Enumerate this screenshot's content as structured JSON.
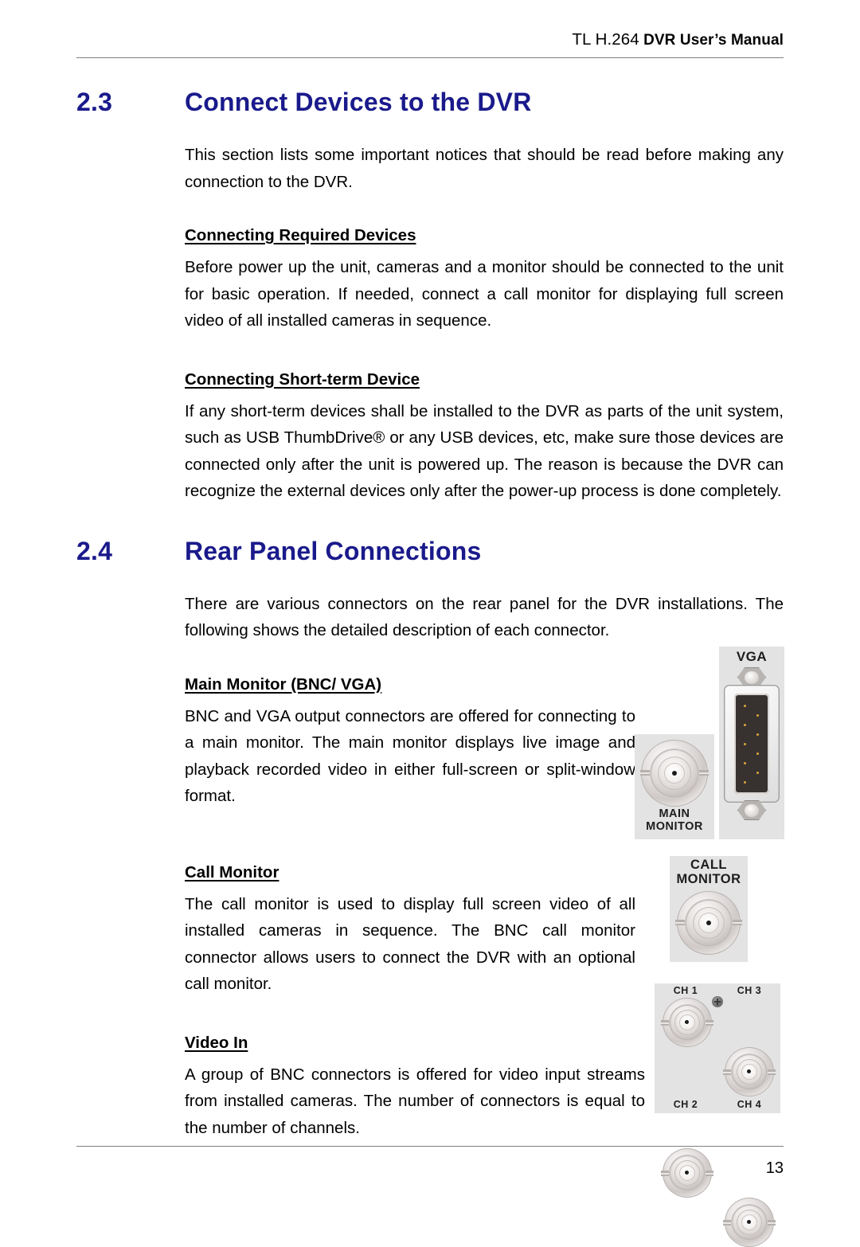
{
  "header": {
    "model": "TL H.264",
    "title": "DVR User’s Manual"
  },
  "footer": {
    "page_number": "13"
  },
  "colors": {
    "heading_blue": "#1a1a8c",
    "rule_gray": "#808080",
    "art_background": "#e3e3e3"
  },
  "sections": [
    {
      "number": "2.3",
      "title": "Connect Devices to the DVR",
      "intro": "This section lists some important notices that should be read before making any connection to the DVR.",
      "subsections": [
        {
          "heading": "Connecting Required Devices",
          "body": "Before power up the unit, cameras and a monitor should be connected to the unit for basic operation. If needed, connect a call monitor for displaying full screen video of all installed cameras in sequence."
        },
        {
          "heading": "Connecting Short-term Device",
          "body": "If any short-term devices shall be installed to the DVR as parts of the unit system, such as USB ThumbDrive® or any USB devices, etc, make sure those devices are connected only after the unit is powered up. The reason is because the DVR can recognize the external devices only after the power-up process is done completely."
        }
      ]
    },
    {
      "number": "2.4",
      "title": "Rear Panel Connections",
      "intro": "There are various connectors on the rear panel for the DVR installations. The following shows the detailed description of each connector.",
      "subsections": [
        {
          "heading": "Main Monitor (BNC/ VGA)",
          "body": "BNC and VGA output connectors are offered for connecting to a main monitor. The main monitor displays live image and playback recorded video in either full-screen or split-window format."
        },
        {
          "heading": "Call Monitor",
          "body": "The call monitor is used to display full screen video of all installed cameras in sequence. The BNC call monitor connector allows users to connect the DVR with an optional call monitor."
        },
        {
          "heading": "Video In",
          "body": "A group of BNC connectors is offered for video input streams from installed cameras. The number of connectors is equal to the number of channels."
        }
      ]
    }
  ],
  "artwork": {
    "main_monitor_panel": {
      "bnc_label_line1": "MAIN",
      "bnc_label_line2": "MONITOR",
      "vga_label": "VGA"
    },
    "call_monitor_panel": {
      "label_line1": "CALL",
      "label_line2": "MONITOR"
    },
    "video_in_panel": {
      "channel_top_left": "CH 1",
      "channel_top_right": "CH 3",
      "channel_bottom_left": "CH 2",
      "channel_bottom_right": "CH 4"
    }
  }
}
